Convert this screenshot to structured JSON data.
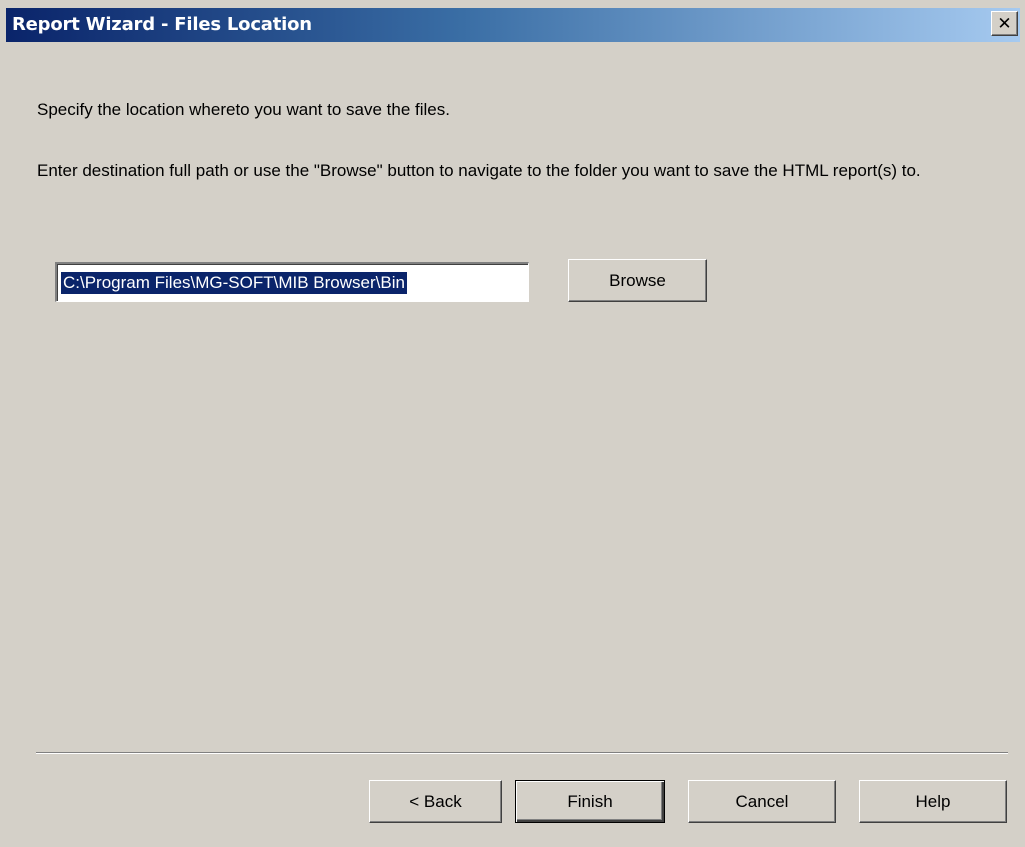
{
  "window": {
    "title": "Report Wizard - Files Location",
    "close_glyph": "✕"
  },
  "instructions": {
    "line1": "Specify the location whereto you want to save the files.",
    "line2": "Enter destination full path or use the \"Browse\" button to navigate to the folder you want to save the HTML report(s) to."
  },
  "path_field": {
    "value": "C:\\Program Files\\MG-SOFT\\MIB Browser\\Bin",
    "selected": true
  },
  "buttons": {
    "browse": "Browse",
    "back": "< Back",
    "finish": "Finish",
    "cancel": "Cancel",
    "help": "Help"
  },
  "colors": {
    "dialog_bg": "#d4d0c8",
    "title_start": "#0a246a",
    "title_end": "#a6caf0",
    "selection_bg": "#0a246a"
  }
}
